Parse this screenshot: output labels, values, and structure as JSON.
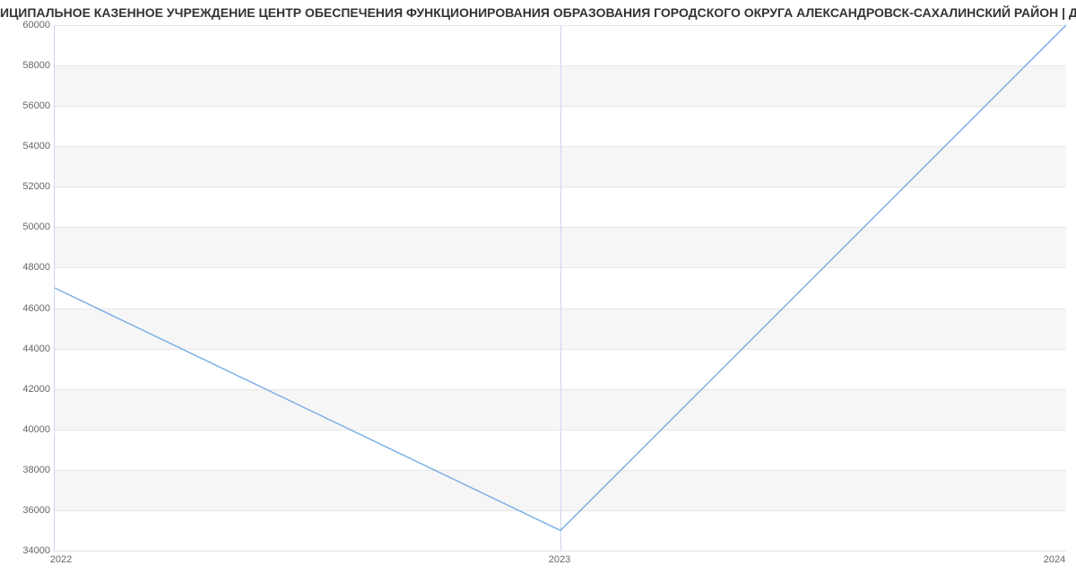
{
  "title": "ИЦИПАЛЬНОЕ КАЗЕННОЕ УЧРЕЖДЕНИЕ ЦЕНТР ОБЕСПЕЧЕНИЯ ФУНКЦИОНИРОВАНИЯ ОБРАЗОВАНИЯ ГОРОДСКОГО ОКРУГА АЛЕКСАНДРОВСК-САХАЛИНСКИЙ РАЙОН | Дан",
  "chart_data": {
    "type": "line",
    "x": [
      2022,
      2023,
      2024
    ],
    "values": [
      47000,
      35000,
      60000
    ],
    "ylim": [
      34000,
      60000
    ],
    "xlim": [
      2022,
      2024
    ],
    "yticks": [
      34000,
      36000,
      38000,
      40000,
      42000,
      44000,
      46000,
      48000,
      50000,
      52000,
      54000,
      56000,
      58000,
      60000
    ],
    "xticks": [
      2022,
      2023,
      2024
    ],
    "color": "#7cb0e6"
  }
}
